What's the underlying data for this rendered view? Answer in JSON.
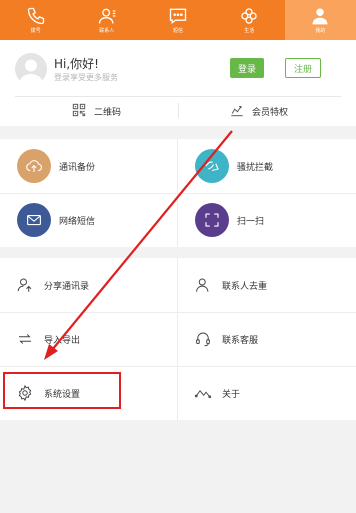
{
  "tabs": [
    {
      "label": "拨号",
      "icon": "phone-icon",
      "active": false
    },
    {
      "label": "联系人",
      "icon": "contacts-icon",
      "active": false
    },
    {
      "label": "短信",
      "icon": "sms-icon",
      "active": false
    },
    {
      "label": "生活",
      "icon": "clover-icon",
      "active": false
    },
    {
      "label": "我的",
      "icon": "person-icon",
      "active": true
    }
  ],
  "user": {
    "greeting": "Hi,你好!",
    "subline": "登录享受更多服务",
    "login_label": "登录",
    "register_label": "注册"
  },
  "quick_links": {
    "qr_label": "二维码",
    "vip_label": "会员特权"
  },
  "features": [
    {
      "label": "通讯备份",
      "icon": "cloud-upload-icon",
      "color": "#d9a26a"
    },
    {
      "label": "骚扰拦截",
      "icon": "shield-block-icon",
      "color": "#3fb4c7"
    },
    {
      "label": "网络短信",
      "icon": "envelope-icon",
      "color": "#3d5a97"
    },
    {
      "label": "扫一扫",
      "icon": "scan-icon",
      "color": "#5a3d8c"
    }
  ],
  "tools": [
    {
      "label": "分享通讯录",
      "icon": "share-contacts-icon"
    },
    {
      "label": "联系人去重",
      "icon": "dedupe-contacts-icon"
    },
    {
      "label": "导入导出",
      "icon": "import-export-icon"
    },
    {
      "label": "联系客服",
      "icon": "headset-icon"
    },
    {
      "label": "系统设置",
      "icon": "settings-gear-icon"
    },
    {
      "label": "关于",
      "icon": "about-icon"
    }
  ],
  "colors": {
    "brand_orange": "#f27d22",
    "active_tab": "#f9a35d",
    "login_green": "#67b847",
    "annotation_red": "#e02020"
  }
}
